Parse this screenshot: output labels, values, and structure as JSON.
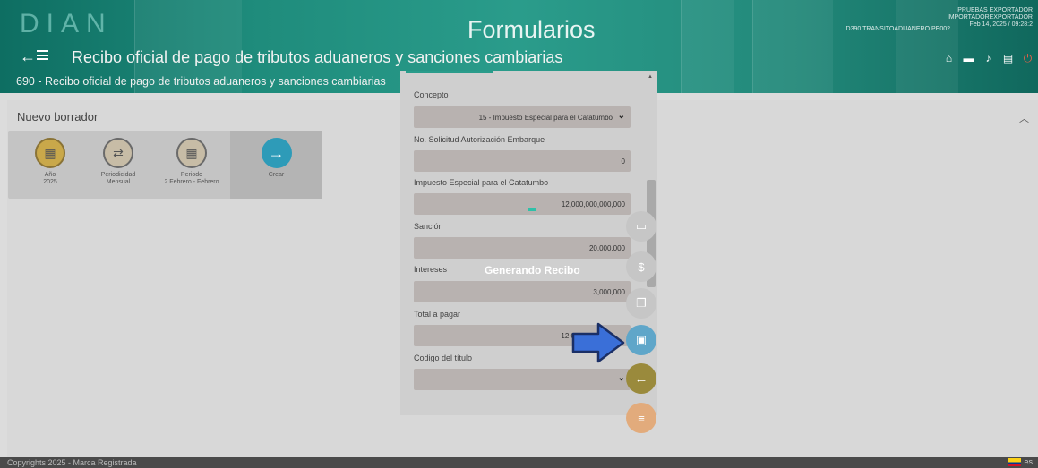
{
  "header": {
    "logo": "DIAN",
    "app_title": "Formularios",
    "user_line1": "PRUEBAS EXPORTADOR",
    "user_line2": "IMPORTADOREXPORTADOR",
    "user_line3": "Feb 14, 2025 / 09:28:2",
    "user_name": "D390 TRANSITOADUANERO PE002",
    "form_title": "Recibo oficial de pago de tributos aduaneros y sanciones cambiarias",
    "subtitle": "690 - Recibo oficial de pago de tributos aduaneros y sanciones cambiarias",
    "icons": [
      "home-icon",
      "folder-icon",
      "bell-icon",
      "calendar-icon",
      "power-icon"
    ]
  },
  "draft": {
    "title": "Nuevo borrador",
    "cards": [
      {
        "label": "Año",
        "value": "2025",
        "icon": "calendar-icon"
      },
      {
        "label": "Periodicidad",
        "value": "Mensual",
        "icon": "repeat-icon"
      },
      {
        "label": "Periodo",
        "value": "2 Febrero - Febrero",
        "icon": "calendar-grid-icon"
      },
      {
        "label": "Crear",
        "value": "",
        "icon": "arrow-right-icon"
      }
    ]
  },
  "modal": {
    "fields": [
      {
        "label": "Concepto",
        "value": "15 - Impuesto Especial para el Catatumbo",
        "type": "select"
      },
      {
        "label": "No. Solicitud Autorización Embarque",
        "value": "0",
        "type": "input"
      },
      {
        "label": "Impuesto Especial para el Catatumbo",
        "value": "12,000,000,000,000",
        "type": "input"
      },
      {
        "label": "Sanción",
        "value": "20,000,000",
        "type": "input"
      },
      {
        "label": "Intereses",
        "value": "3,000,000",
        "type": "input"
      },
      {
        "label": "Total a pagar",
        "value": "12,0",
        "value_tail": "00",
        "type": "input"
      },
      {
        "label": "Codigo del título",
        "value": "",
        "type": "select"
      }
    ],
    "loading_text": "Generando Recibo"
  },
  "fabs": [
    "credit-card-icon",
    "dollar-icon",
    "copy-icon",
    "save-icon",
    "back-arrow-icon",
    "menu-icon"
  ],
  "footer": {
    "copyright": "Copyrights 2025 - Marca Registrada",
    "lang": "es"
  },
  "colors": {
    "header": "#1f8c7c",
    "save_fab": "#5fa6c9",
    "back_fab": "#9a8a3c",
    "menu_fab": "#e2ab7c",
    "annotation_arrow": "#3a6fd8"
  }
}
